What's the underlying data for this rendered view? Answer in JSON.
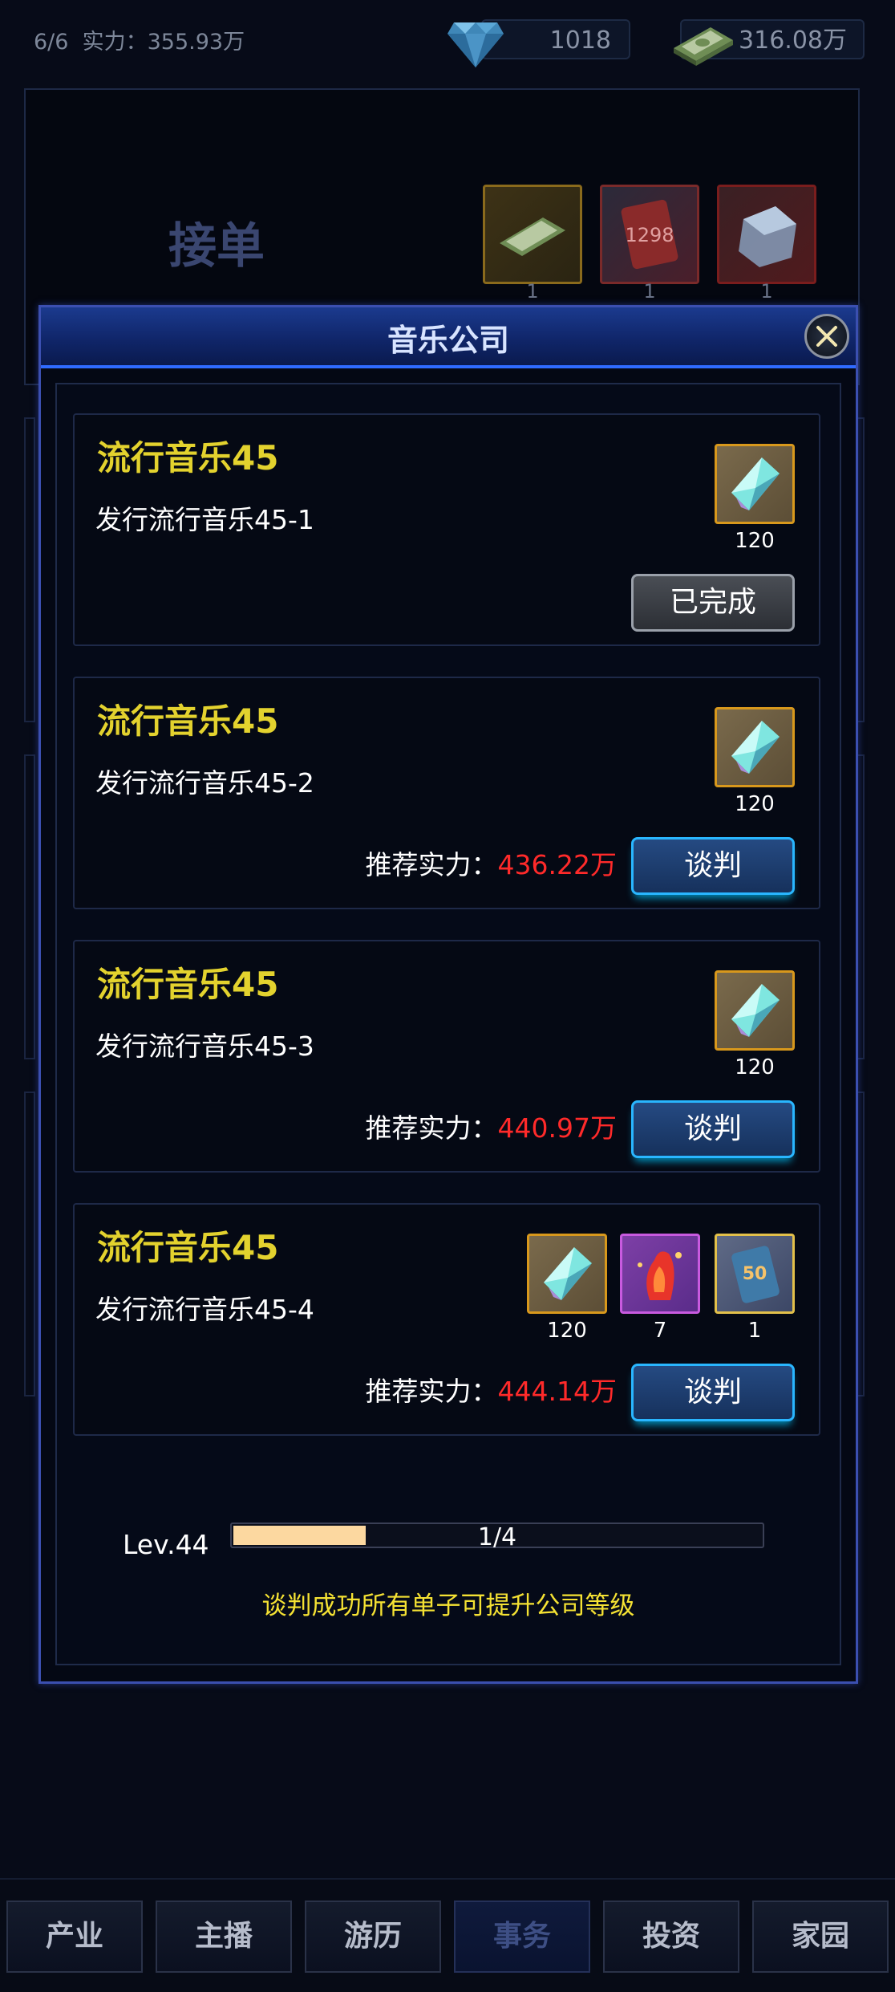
{
  "top": {
    "slots": "6/6",
    "power_label": "实力：",
    "power_value": "355.93万",
    "diamonds": "1018",
    "cash": "316.08万"
  },
  "background": {
    "title": "接单",
    "reward_counts": [
      "1",
      "1",
      "1"
    ],
    "card_label": "1298"
  },
  "modal": {
    "title": "音乐公司",
    "recommend_label": "推荐实力：",
    "tasks": [
      {
        "name": "流行音乐45",
        "desc": "发行流行音乐45-1",
        "rewards": [
          {
            "icon": "crystal-icon",
            "count": "120"
          }
        ],
        "status": "已完成",
        "recommend": ""
      },
      {
        "name": "流行音乐45",
        "desc": "发行流行音乐45-2",
        "rewards": [
          {
            "icon": "crystal-icon",
            "count": "120"
          }
        ],
        "button": "谈判",
        "recommend": "436.22万"
      },
      {
        "name": "流行音乐45",
        "desc": "发行流行音乐45-3",
        "rewards": [
          {
            "icon": "crystal-icon",
            "count": "120"
          }
        ],
        "button": "谈判",
        "recommend": "440.97万"
      },
      {
        "name": "流行音乐45",
        "desc": "发行流行音乐45-4",
        "rewards": [
          {
            "icon": "crystal-icon",
            "count": "120"
          },
          {
            "icon": "fire-lantern-icon",
            "count": "7"
          },
          {
            "icon": "card-50-icon",
            "count": "1",
            "label": "50"
          }
        ],
        "button": "谈判",
        "recommend": "444.14万"
      }
    ],
    "level": {
      "label": "Lev.44",
      "progress_text": "1/4",
      "progress_fraction": 0.25,
      "hint": "谈判成功所有单子可提升公司等级"
    }
  },
  "nav": [
    "产业",
    "主播",
    "游历",
    "事务",
    "投资",
    "家园"
  ],
  "nav_active": "事务",
  "colors": {
    "task_name": "#e3d22e",
    "recommend_value": "#ff2a2a",
    "hint": "#f5e233",
    "progress_fill": "#fcd8a0",
    "negotiate_border": "#29b6ff"
  }
}
